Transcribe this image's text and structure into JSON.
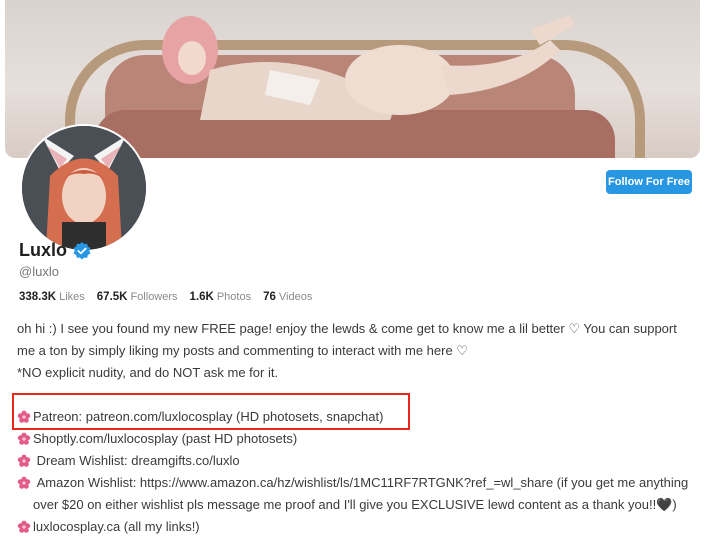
{
  "profile": {
    "name": "Luxlo",
    "handle": "@luxlo",
    "follow_label": "Follow For Free"
  },
  "stats": [
    {
      "value": "338.3K",
      "label": "Likes"
    },
    {
      "value": "67.5K",
      "label": "Followers"
    },
    {
      "value": "1.6K",
      "label": "Photos"
    },
    {
      "value": "76",
      "label": "Videos"
    }
  ],
  "bio": {
    "line1": "oh hi :) I see you found my new FREE page! enjoy the lewds & come get to know me a lil better ♡ You can support me a ton by simply liking my posts and commenting to interact with me here ♡",
    "line2": "*NO explicit nudity, and do NOT ask me for it.",
    "links": [
      "Patreon: patreon.com/luxlocosplay (HD photosets, snapchat)",
      "Shoptly.com/luxlocosplay (past HD photosets)",
      " Dream Wishlist: dreamgifts.co/luxlo",
      " Amazon Wishlist: https://www.amazon.ca/hz/wishlist/ls/1MC11RF7RTGNK?ref_=wl_share (if you get me anything over $20 on either wishlist pls message me proof and I'll give you EXCLUSIVE lewd content as a thank you!!🖤)",
      "luxlocosplay.ca (all my links!)"
    ]
  },
  "colors": {
    "accent": "#2797e3",
    "highlight_border": "#e8281b",
    "verified": "#2797e3"
  },
  "icons": {
    "verified": "verified-badge-icon",
    "link_bullet": "flower-icon"
  }
}
